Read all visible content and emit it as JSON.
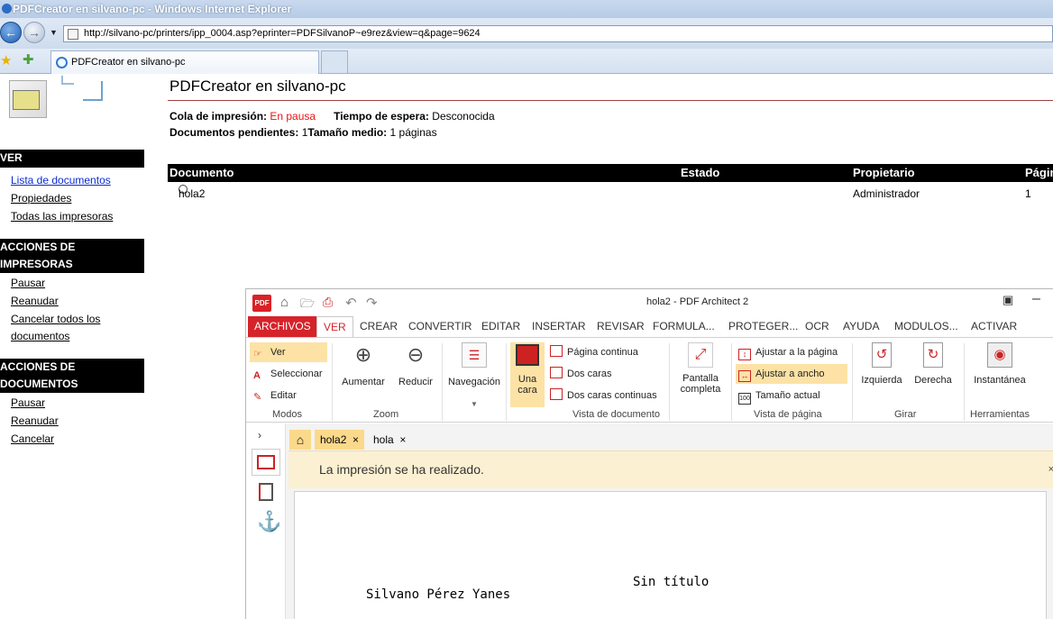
{
  "browser": {
    "title": "PDFCreator en silvano-pc - Windows Internet Explorer",
    "url": "http://silvano-pc/printers/ipp_0004.asp?eprinter=PDFSilvanoP~e9rez&view=q&page=9624",
    "tab_label": "PDFCreator en silvano-pc"
  },
  "page": {
    "title": "PDFCreator en silvano-pc",
    "queue_label": "Cola de impresión:",
    "queue_value": "En pausa",
    "wait_label": "Tiempo de espera:",
    "wait_value": "Desconocida",
    "pending_label": "Documentos pendientes:",
    "pending_value": "1",
    "avg_label": "Tamaño medio:",
    "avg_value": "1 páginas",
    "table": {
      "headers": [
        "Documento",
        "Estado",
        "Propietario",
        "Págin"
      ],
      "rows": [
        [
          "hola2",
          "",
          "Administrador",
          "1"
        ]
      ]
    }
  },
  "sidebar": {
    "ver_header": "VER",
    "ver_links": [
      "Lista de documentos",
      "Propiedades",
      "Todas las impresoras"
    ],
    "printer_actions_header_1": "ACCIONES DE",
    "printer_actions_header_2": "IMPRESORAS",
    "printer_actions": [
      "Pausar",
      "Reanudar",
      "Cancelar todos los",
      "documentos"
    ],
    "doc_actions_header_1": "ACCIONES DE",
    "doc_actions_header_2": "DOCUMENTOS",
    "doc_actions": [
      "Pausar",
      "Reanudar",
      "Cancelar"
    ]
  },
  "architect": {
    "logo": "PDF",
    "title": "hola2   -   PDF Architect 2",
    "menu": [
      "ARCHIVOS",
      "VER",
      "CREAR",
      "CONVERTIR",
      "EDITAR",
      "INSERTAR",
      "REVISAR",
      "FORMULA...",
      "PROTEGER...",
      "OCR",
      "AYUDA",
      "MODULOS...",
      "ACTIVAR"
    ],
    "ribbon": {
      "modos": [
        "Ver",
        "Seleccionar",
        "Editar"
      ],
      "modos_label": "Modos",
      "zoom": [
        "Aumentar",
        "Reducir"
      ],
      "zoom_label": "Zoom",
      "navegacion": "Navegación",
      "una_cara_1": "Una",
      "una_cara_2": "cara",
      "vista_items": [
        "Página continua",
        "Dos caras",
        "Dos caras continuas"
      ],
      "vista_label": "Vista de documento",
      "pantalla_1": "Pantalla",
      "pantalla_2": "completa",
      "pagina_items": [
        "Ajustar a la página",
        "Ajustar a ancho",
        "Tamaño actual"
      ],
      "pagina_label": "Vista de página",
      "girar": [
        "Izquierda",
        "Derecha"
      ],
      "girar_label": "Girar",
      "instantanea": "Instantánea",
      "herramientas_label": "Herramientas"
    },
    "tabs": [
      "hola2",
      "hola"
    ],
    "notice": "La impresión se ha realizado.",
    "doc_title": "Sin título",
    "doc_author": "Silvano Pérez Yanes"
  }
}
